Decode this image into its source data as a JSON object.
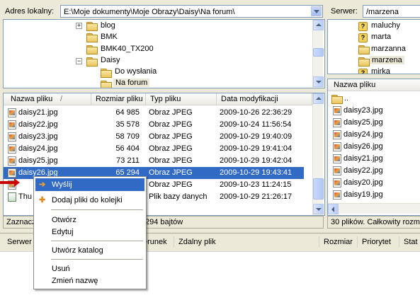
{
  "local": {
    "address_label": "Adres lokalny:",
    "address_value": "E:\\Moje dokumenty\\Moje Obrazy\\Daisy\\Na forum\\",
    "tree": [
      "blog",
      "BMK",
      "BMK40_TX200",
      "Daisy",
      "Do wysłania",
      "Na forum"
    ],
    "columns": [
      "Nazwa pliku",
      "Rozmiar pliku",
      "Typ pliku",
      "Data modyfikacji"
    ],
    "sort_indicator": "/",
    "files": [
      {
        "name": "daisy21.jpg",
        "size": "64 985",
        "type": "Obraz JPEG",
        "date": "2009-10-26 22:36:29"
      },
      {
        "name": "daisy22.jpg",
        "size": "35 578",
        "type": "Obraz JPEG",
        "date": "2009-10-24 11:56:54"
      },
      {
        "name": "daisy23.jpg",
        "size": "58 709",
        "type": "Obraz JPEG",
        "date": "2009-10-29 19:40:09"
      },
      {
        "name": "daisy24.jpg",
        "size": "56 404",
        "type": "Obraz JPEG",
        "date": "2009-10-29 19:41:04"
      },
      {
        "name": "daisy25.jpg",
        "size": "73 211",
        "type": "Obraz JPEG",
        "date": "2009-10-29 19:42:04"
      },
      {
        "name": "daisy26.jpg",
        "size": "65 294",
        "type": "Obraz JPEG",
        "date": "2009-10-29 19:43:41"
      },
      {
        "name": "",
        "size": "",
        "type": "Obraz JPEG",
        "date": "2009-10-23 11:24:15"
      },
      {
        "name": "Thu",
        "size": "",
        "type": "Plik bazy danych",
        "date": "2009-10-29 21:26:17"
      }
    ],
    "status_left": "Zaznacz",
    "status_right": "294 bajtów"
  },
  "remote": {
    "server_label": "Serwer:",
    "server_value": "/marzena",
    "tree": [
      "maluchy",
      "marta",
      "marzanna",
      "marzena",
      "mirka"
    ],
    "column": "Nazwa pliku",
    "files": [
      "..",
      "daisy23.jpg",
      "daisy25.jpg",
      "daisy24.jpg",
      "daisy26.jpg",
      "daisy21.jpg",
      "daisy22.jpg",
      "daisy20.jpg",
      "daisy19.jpg"
    ],
    "status": "30 plików. Całkowity rozmiar"
  },
  "queue": {
    "columns": [
      "Serwer",
      "erunek",
      "Zdalny plik",
      "Rozmiar",
      "Priorytet",
      "Stat"
    ]
  },
  "context_menu": {
    "items": [
      "Wyślij",
      "Dodaj pliki do kolejki",
      "Otwórz",
      "Edytuj",
      "Utwórz katalog",
      "Usuń",
      "Zmień nazwę"
    ],
    "highlighted": 0
  },
  "colors": {
    "selection": "#316ac5",
    "arrow": "#cc0000"
  }
}
